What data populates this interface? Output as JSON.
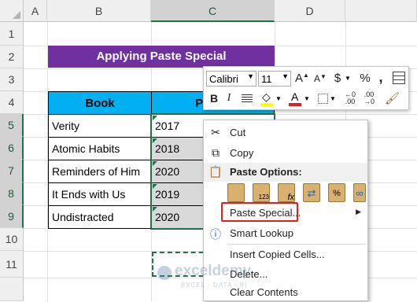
{
  "sheet": {
    "columns": [
      "A",
      "B",
      "C",
      "D"
    ],
    "rows": [
      "1",
      "2",
      "3",
      "4",
      "5",
      "6",
      "7",
      "8",
      "9",
      "10",
      "11"
    ]
  },
  "title": "Applying Paste Special",
  "table": {
    "header_book": "Book",
    "header_published": "Publis",
    "rows": [
      {
        "book": "Verity",
        "year": "2017"
      },
      {
        "book": "Atomic Habits",
        "year": "2018"
      },
      {
        "book": "Reminders of Him",
        "year": "2020"
      },
      {
        "book": "It Ends with Us",
        "year": "2019"
      },
      {
        "book": "Undistracted",
        "year": "2020"
      }
    ]
  },
  "mini_toolbar": {
    "font": "Calibri",
    "size": "11",
    "buttons_row1": [
      "A",
      "A",
      "$",
      "%",
      ","
    ],
    "buttons_row2": [
      "B",
      "I"
    ]
  },
  "context_menu": {
    "cut": "Cut",
    "copy": "Copy",
    "paste_options_header": "Paste Options:",
    "paste_special": "Paste Special...",
    "smart_lookup": "Smart Lookup",
    "insert_copied": "Insert Copied Cells...",
    "delete": "Delete...",
    "clear_contents": "Clear Contents"
  },
  "watermark": {
    "brand": "exceldemy",
    "tagline": "EXCEL · DATA · BI"
  },
  "colors": {
    "title_bg": "#7030a0",
    "header_bg": "#00b0f0",
    "excel_green": "#217346",
    "highlight_red": "#e02020"
  }
}
